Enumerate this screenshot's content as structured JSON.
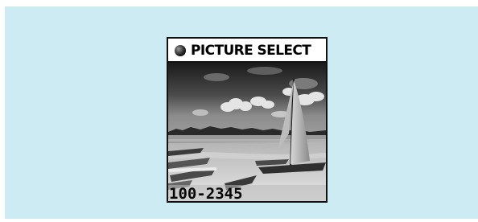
{
  "screen": {
    "title": "PICTURE SELECT",
    "title_icon": "bullet-icon",
    "picture_number": "100-2345"
  },
  "photo": {
    "subject": "beach with sailboat",
    "tone": "grayscale"
  },
  "colors": {
    "background_panel": "#cdebf3",
    "screen_border": "#111111",
    "header_bg": "#ffffff",
    "text": "#000000"
  }
}
